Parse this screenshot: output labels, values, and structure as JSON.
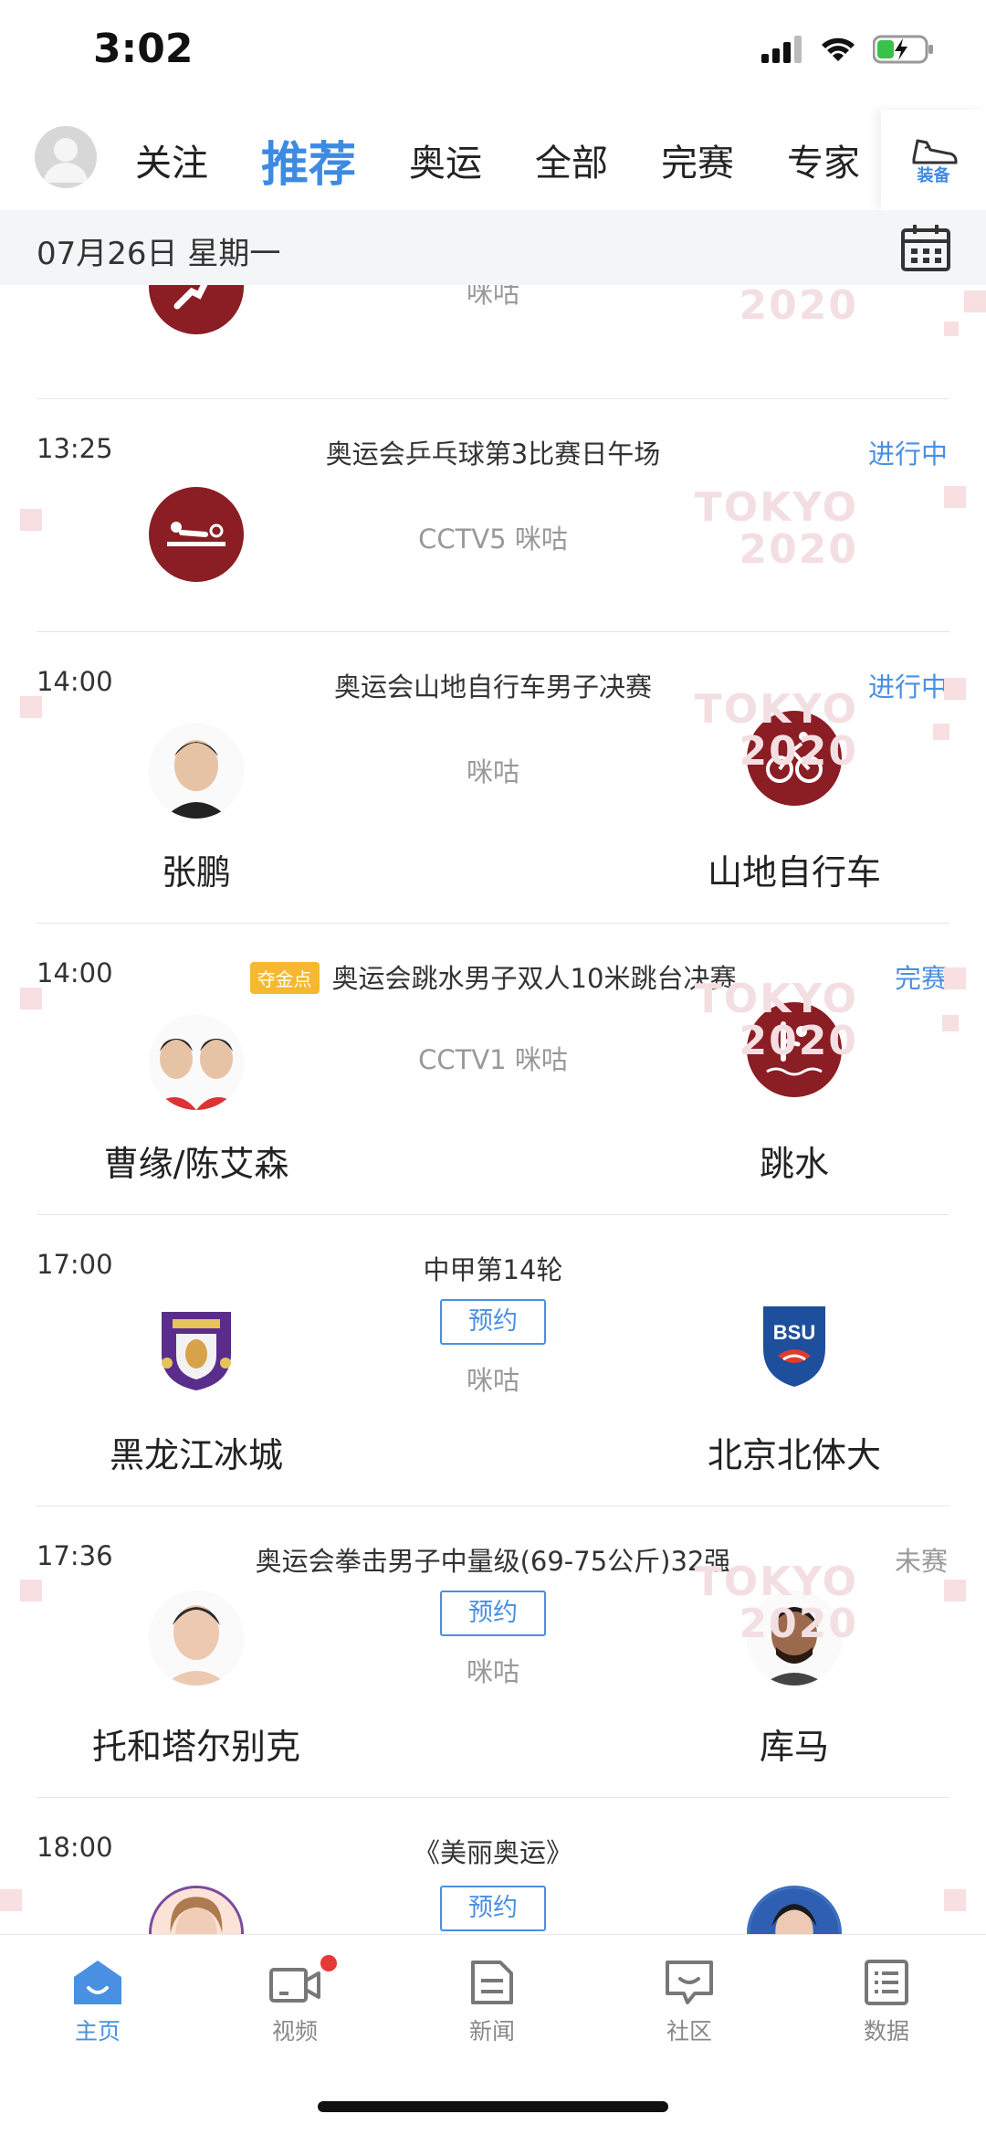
{
  "status_bar": {
    "time": "3:02"
  },
  "top_nav": {
    "tabs": [
      "关注",
      "推荐",
      "奥运",
      "全部",
      "完赛",
      "专家"
    ],
    "active_tab": "推荐",
    "gear_label": "装备"
  },
  "date_bar": {
    "date": "07月26日 星期一"
  },
  "matches": [
    {
      "channel": "咪咕"
    },
    {
      "time": "13:25",
      "title": "奥运会乒乓球第3比赛日午场",
      "status": "进行中",
      "channel": "CCTV5 咪咕",
      "watermark": "TOKYO\n2020"
    },
    {
      "time": "14:00",
      "title": "奥运会山地自行车男子决赛",
      "status": "进行中",
      "channel": "咪咕",
      "left_name": "张鹏",
      "right_name": "山地自行车"
    },
    {
      "time": "14:00",
      "badge": "夺金点",
      "title": "奥运会跳水男子双人10米跳台决赛",
      "status": "完赛",
      "channel": "CCTV1 咪咕",
      "left_name": "曹缘/陈艾森",
      "right_name": "跳水"
    },
    {
      "time": "17:00",
      "title": "中甲第14轮",
      "reserve": "预约",
      "channel": "咪咕",
      "left_name": "黑龙江冰城",
      "right_name": "北京北体大"
    },
    {
      "time": "17:36",
      "title": "奥运会拳击男子中量级(69-75公斤)32强",
      "status": "未赛",
      "reserve": "预约",
      "channel": "咪咕",
      "left_name": "托和塔尔别克",
      "right_name": "库马"
    },
    {
      "time": "18:00",
      "title": "《美丽奥运》",
      "reserve": "预约"
    }
  ],
  "bottom_nav": {
    "items": [
      "主页",
      "视频",
      "新闻",
      "社区",
      "数据"
    ],
    "active": "主页"
  },
  "colors": {
    "accent": "#4a90e2",
    "sport_badge": "#8b1d24",
    "gold_badge": "#f5b82e",
    "notify_dot": "#e53935"
  }
}
